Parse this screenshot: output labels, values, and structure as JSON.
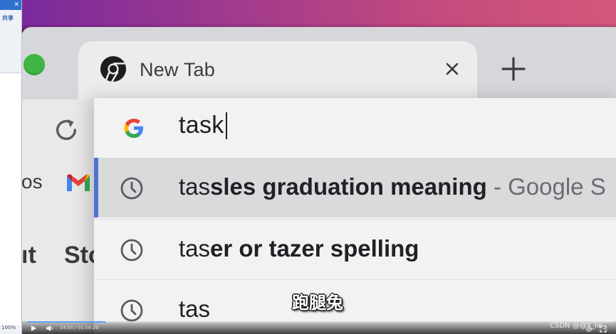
{
  "left_panel": {
    "close": "✕",
    "share": "共享",
    "zoom": "100%"
  },
  "tab": {
    "title": "New Tab"
  },
  "omnibox": {
    "query": "task",
    "suggestions": [
      {
        "match": "tas",
        "rest": "sles graduation meaning",
        "source": " - Google S"
      },
      {
        "match": "tas",
        "rest": "er or tazer spelling",
        "source": ""
      },
      {
        "match": "tas",
        "rest": "",
        "source": ""
      }
    ]
  },
  "bookmarks": {
    "partial_1": "os",
    "partial_2": "ıt",
    "partial_3": "Sto"
  },
  "subtitle": "跑腿兔",
  "video": {
    "time": "14:50 / 01:50:29",
    "progress": 0.134,
    "watermark": "CSDN @@Y_lin_"
  },
  "colors": {
    "accent": "#4c74cf",
    "traffic_green": "#3fb644",
    "wallpaper_start": "#7a2a9c",
    "wallpaper_end": "#d4577b"
  }
}
